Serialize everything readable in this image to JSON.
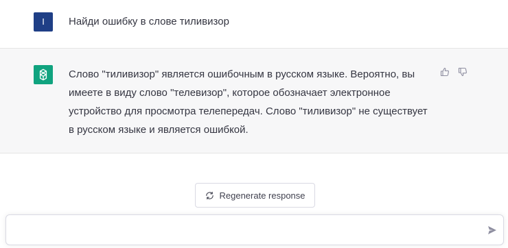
{
  "user_message": {
    "avatar_initial": "I",
    "text": "Найди ошибку в слове тиливизор"
  },
  "assistant_message": {
    "avatar_icon": "openai-logo-icon",
    "text": "Слово \"тиливизор\" является ошибочным в русском языке. Вероятно, вы имеете в виду слово \"телевизор\", которое обозначает электронное устройство для просмотра телепередач. Слово \"тиливизор\" не существует в русском языке и является ошибкой.",
    "feedback_icons": [
      "thumbs-up-icon",
      "thumbs-down-icon"
    ]
  },
  "regenerate": {
    "label": "Regenerate response",
    "icon": "refresh-icon"
  },
  "composer": {
    "value": "",
    "send_icon": "send-icon"
  },
  "colors": {
    "user_avatar": "#1f3f86",
    "assistant_avatar": "#10a37f",
    "assistant_background": "#f7f7f8"
  }
}
